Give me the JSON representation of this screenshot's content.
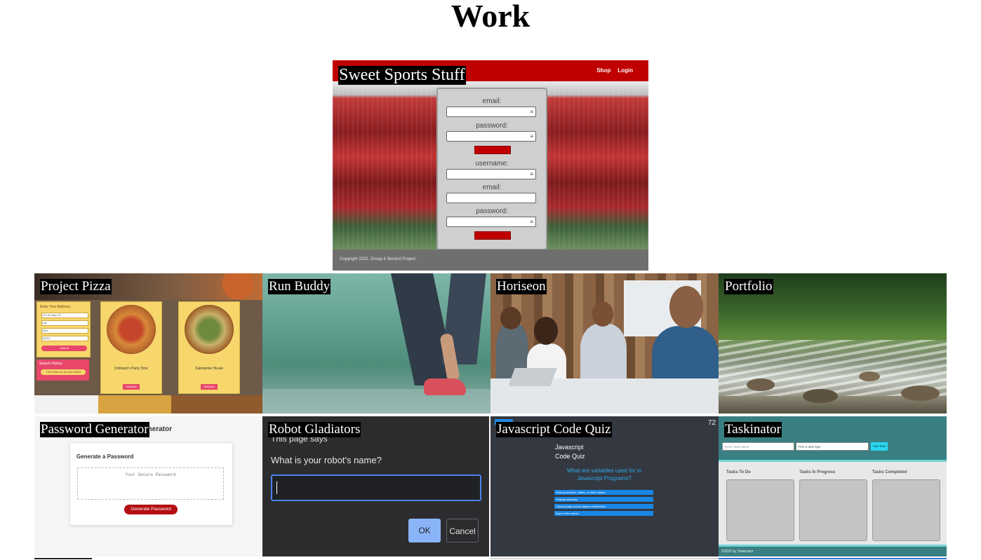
{
  "page": {
    "title": "Work"
  },
  "projects": {
    "hero": {
      "caption": "Sweet Sports Stuff",
      "nav": [
        "Shop",
        "Login"
      ],
      "form": {
        "login_labels": [
          "email:",
          "password:"
        ],
        "signup_labels": [
          "username:",
          "email:",
          "password:"
        ]
      },
      "footer": "Copyright 2022. Group 4 Second Project."
    },
    "pizza": {
      "caption": "Project Pizza",
      "address_label": "Enter Your Address:",
      "address_values": [
        "175 W Main St",
        "City",
        "Ohio",
        "43015"
      ],
      "submit_label": "Submit",
      "history_label": "Search History",
      "history_item": "175 W Main St City, Ohio 43015",
      "restaurants": [
        "Ordinary's Party Time",
        "Submarine House"
      ],
      "directions_label": "Directions"
    },
    "run": {
      "caption": "Run Buddy"
    },
    "hori": {
      "caption": "Horiseon"
    },
    "port": {
      "caption": "Portfolio"
    },
    "pass": {
      "caption": "Password Generator",
      "header_suffix": "enerator",
      "card_title": "Generate a Password",
      "placeholder": "Your Secure Password",
      "button": "Generate Password"
    },
    "robot": {
      "caption": "Robot Gladiators",
      "page_says": "This page says",
      "question": "What is your robot's name?",
      "ok": "OK",
      "cancel": "Cancel"
    },
    "quiz": {
      "caption": "Javascript Code Quiz",
      "timer": "72",
      "title_line1": "Javascript",
      "title_line2": "Code Quiz",
      "question": "What are variables used for in Javascript Programs?",
      "options": [
        "Storing numbers, dates, or other values",
        "Varying randomly",
        "Causing high-school algebra flashbacks",
        "None of the above"
      ]
    },
    "task": {
      "caption": "Taskinator",
      "name_placeholder": "Enter Task Name",
      "type_placeholder": "Pick a task type",
      "add_button": "Add Task",
      "columns": [
        "Tasks To Do",
        "Tasks In Progress",
        "Tasks Completed"
      ],
      "footer": "©2020 by Taskinator"
    }
  }
}
